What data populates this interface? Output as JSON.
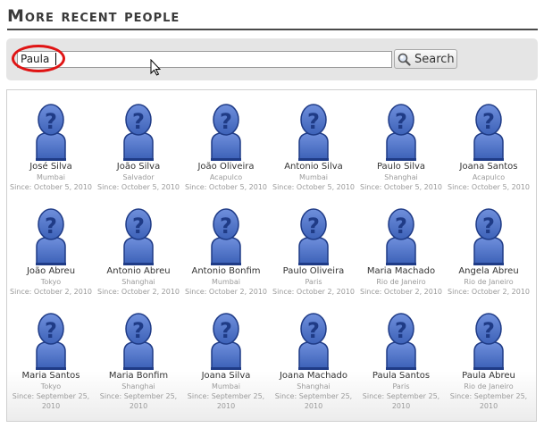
{
  "title": "More recent people",
  "search": {
    "value": "Paula",
    "button_label": "Search"
  },
  "people": [
    {
      "name": "José Silva",
      "city": "Mumbai",
      "since": "Since: October 5, 2010"
    },
    {
      "name": "João Silva",
      "city": "Salvador",
      "since": "Since: October 5, 2010"
    },
    {
      "name": "João Oliveira",
      "city": "Acapulco",
      "since": "Since: October 5, 2010"
    },
    {
      "name": "Antonio Silva",
      "city": "Mumbai",
      "since": "Since: October 5, 2010"
    },
    {
      "name": "Paulo Silva",
      "city": "Shanghai",
      "since": "Since: October 5, 2010"
    },
    {
      "name": "Joana Santos",
      "city": "Acapulco",
      "since": "Since: October 5, 2010"
    },
    {
      "name": "João Abreu",
      "city": "Tokyo",
      "since": "Since: October 2, 2010"
    },
    {
      "name": "Antonio Abreu",
      "city": "Shanghai",
      "since": "Since: October 2, 2010"
    },
    {
      "name": "Antonio Bonfim",
      "city": "Mumbai",
      "since": "Since: October 2, 2010"
    },
    {
      "name": "Paulo Oliveira",
      "city": "Paris",
      "since": "Since: October 2, 2010"
    },
    {
      "name": "Maria Machado",
      "city": "Rio de Janeiro",
      "since": "Since: October 2, 2010"
    },
    {
      "name": "Angela Abreu",
      "city": "Rio de Janeiro",
      "since": "Since: October 2, 2010"
    },
    {
      "name": "Maria Santos",
      "city": "Tokyo",
      "since": "Since: September 25, 2010"
    },
    {
      "name": "Maria Bonfim",
      "city": "Shanghai",
      "since": "Since: September 25, 2010"
    },
    {
      "name": "Joana Silva",
      "city": "Mumbai",
      "since": "Since: September 25, 2010"
    },
    {
      "name": "Joana Machado",
      "city": "Shanghai",
      "since": "Since: September 25, 2010"
    },
    {
      "name": "Paula Santos",
      "city": "Paris",
      "since": "Since: September 25, 2010"
    },
    {
      "name": "Paula Abreu",
      "city": "Rio de Janeiro",
      "since": "Since: September 25, 2010"
    }
  ],
  "colors": {
    "avatar_fill": "#3d62b8",
    "avatar_dark": "#1f3b86",
    "highlight": "#e01414"
  },
  "icons": {
    "avatar": "unknown-person-icon",
    "search": "magnifier-icon",
    "cursor": "mouse-pointer-icon"
  }
}
